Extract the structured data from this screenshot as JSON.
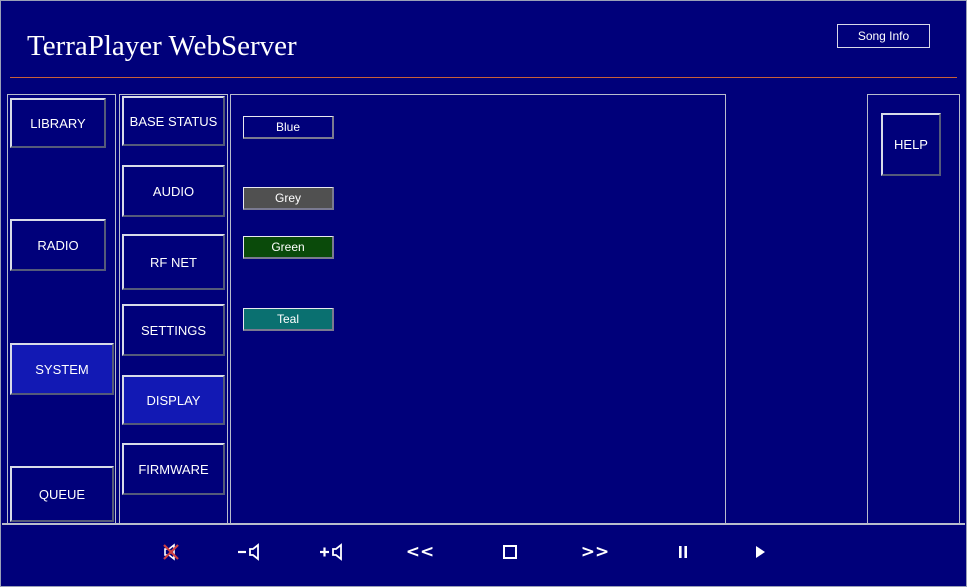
{
  "header": {
    "title": "TerraPlayer WebServer",
    "song_info_label": "Song Info"
  },
  "primary_nav": [
    {
      "label": "LIBRARY",
      "active": false
    },
    {
      "label": "RADIO",
      "active": false
    },
    {
      "label": "SYSTEM",
      "active": true
    },
    {
      "label": "QUEUE",
      "active": false
    }
  ],
  "secondary_nav": [
    {
      "label": "BASE STATUS",
      "active": false
    },
    {
      "label": "AUDIO",
      "active": false
    },
    {
      "label": "RF NET",
      "active": false
    },
    {
      "label": "SETTINGS",
      "active": false
    },
    {
      "label": "DISPLAY",
      "active": true
    },
    {
      "label": "FIRMWARE",
      "active": false
    }
  ],
  "display_themes": [
    {
      "label": "Blue",
      "color": "#00007a"
    },
    {
      "label": "Grey",
      "color": "#505050"
    },
    {
      "label": "Green",
      "color": "#0a4a0a"
    },
    {
      "label": "Teal",
      "color": "#0a7070"
    }
  ],
  "help_label": "HELP",
  "transport": {
    "icons": [
      "mute-icon",
      "volume-down-icon",
      "volume-up-icon",
      "previous-icon",
      "stop-icon",
      "next-icon",
      "pause-icon",
      "play-icon"
    ],
    "prev_label": "<<",
    "next_label": ">>"
  },
  "colors": {
    "background": "#00007a",
    "active_button": "#1219b4",
    "rule": "#c8603a",
    "mute_icon": "#d04040"
  }
}
